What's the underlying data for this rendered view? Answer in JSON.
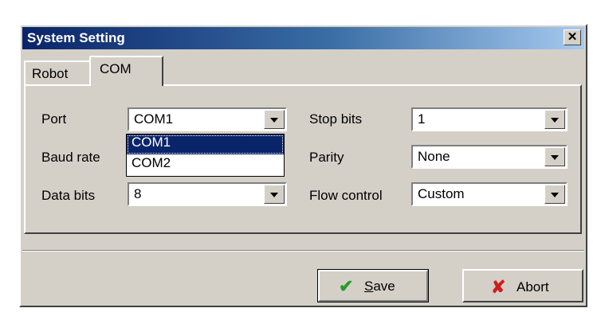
{
  "dialog": {
    "title": "System Setting",
    "close_label": "✕"
  },
  "tabs": [
    {
      "label": "Robot"
    },
    {
      "label": "COM"
    }
  ],
  "fields": {
    "port": {
      "label": "Port",
      "value": "COM1"
    },
    "baud_rate": {
      "label": "Baud rate"
    },
    "data_bits": {
      "label": "Data bits",
      "value": "8"
    },
    "stop_bits": {
      "label": "Stop bits",
      "value": "1"
    },
    "parity": {
      "label": "Parity",
      "value": "None"
    },
    "flow_control": {
      "label": "Flow control",
      "value": "Custom"
    }
  },
  "port_dropdown": {
    "options": [
      "COM1",
      "COM2"
    ],
    "selected": "COM1"
  },
  "buttons": {
    "save_label": "Save",
    "abort_label": "Abort"
  },
  "colors": {
    "title_bar": "#0a246a",
    "face": "#d4d0c8",
    "save_icon": "#2a9a2a",
    "abort_icon": "#cc1f1f"
  }
}
